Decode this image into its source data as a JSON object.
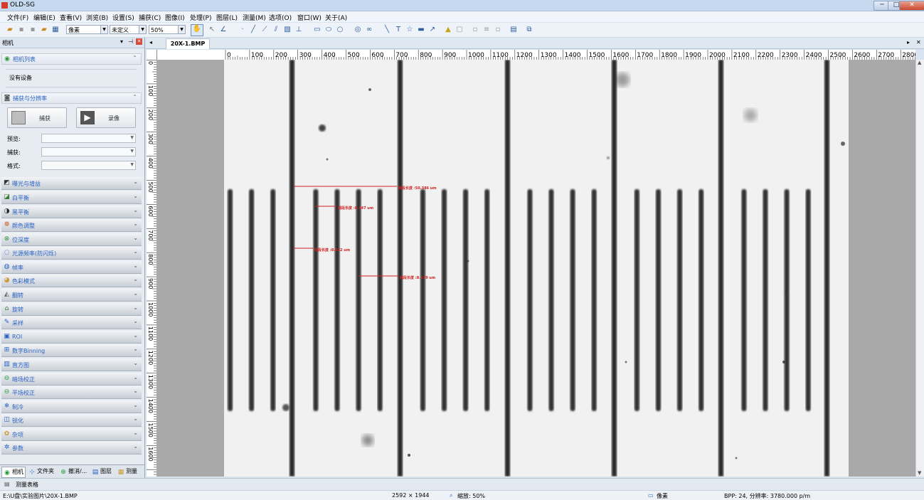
{
  "window": {
    "title": "OLD-SG",
    "min_label": "─",
    "max_label": "□",
    "close_label": "✕"
  },
  "menu": [
    "文件(F)",
    "编辑(E)",
    "查看(V)",
    "浏览(B)",
    "设置(S)",
    "捕获(C)",
    "图像(I)",
    "处理(P)",
    "图层(L)",
    "测量(M)",
    "选项(O)",
    "窗口(W)",
    "关于(A)"
  ],
  "toolbar": {
    "unit_value": "像素",
    "scale_value": "未定义",
    "zoom_value": "50%"
  },
  "left_panel": {
    "title": "相机",
    "camera_list": {
      "title": "相机列表",
      "empty_text": "没有设备"
    },
    "capture": {
      "title": "捕获与分辨率",
      "capture_label": "捕获",
      "record_label": "录像",
      "preview_label": "预览:",
      "capture_res_label": "捕获:",
      "format_label": "格式:"
    },
    "items": [
      "曝光与增益",
      "白平衡",
      "黑平衡",
      "颜色调整",
      "位深度",
      "光源频率(防闪烁)",
      "帧率",
      "色彩模式",
      "翻转",
      "旋转",
      "采样",
      "ROI",
      "数字Binning",
      "直方图",
      "暗场校正",
      "平场校正",
      "制冷",
      "锐化",
      "杂项",
      "参数"
    ],
    "tabs": [
      "相机",
      "文件夹",
      "撤消/...",
      "图层",
      "测量"
    ]
  },
  "document": {
    "tab_label": "20X-1.BMP"
  },
  "ruler_top": [
    "0",
    "100",
    "200",
    "300",
    "400",
    "500",
    "600",
    "700",
    "800",
    "900",
    "1000",
    "1100",
    "1200",
    "1300",
    "1400",
    "1500",
    "1600",
    "1700",
    "1800",
    "1900",
    "2000",
    "2100",
    "2200",
    "2300",
    "2400",
    "2500",
    "2600",
    "2700",
    "2800"
  ],
  "ruler_left": [
    "0",
    "100",
    "200",
    "300",
    "400",
    "500",
    "600",
    "700",
    "800",
    "900",
    "1000",
    "1100",
    "1200",
    "1300",
    "1400",
    "1500",
    "1600"
  ],
  "measurements": [
    {
      "label": "线段长度 :50.386 um"
    },
    {
      "label": "线段长度 :8.147 um"
    },
    {
      "label": "线段长度 :8.022 um"
    },
    {
      "label": "线段长度 :8.179 um"
    }
  ],
  "measure_bar": {
    "label": "测量表格"
  },
  "status": {
    "path": "E:\\U盘\\实验图片\\20X-1.BMP",
    "dimensions": "2592 × 1944",
    "zoom": "缩放: 50%",
    "unit": "像素",
    "bpp": "BPP: 24, 分辨率: 3780.000 p/m"
  },
  "colors": {
    "accent": "#2a62c2",
    "measure_line": "#d42020"
  }
}
